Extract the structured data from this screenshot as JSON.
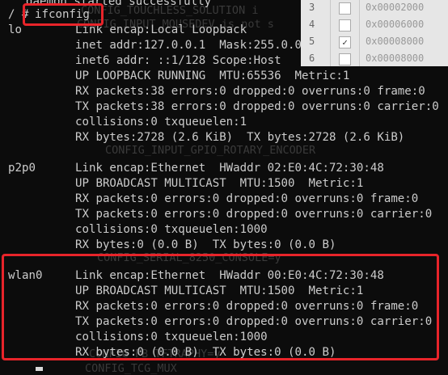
{
  "terminal": {
    "top_partial": "daemon started successfully",
    "prompt": "/ #",
    "command": "ifconfig",
    "interfaces": [
      {
        "name": "lo",
        "lines": [
          "Link encap:Local Loopback",
          "inet addr:127.0.0.1  Mask:255.0.0.0",
          "inet6 addr: ::1/128 Scope:Host",
          "UP LOOPBACK RUNNING  MTU:65536  Metric:1",
          "RX packets:38 errors:0 dropped:0 overruns:0 frame:0",
          "TX packets:38 errors:0 dropped:0 overruns:0 carrier:0",
          "collisions:0 txqueuelen:1",
          "RX bytes:2728 (2.6 KiB)  TX bytes:2728 (2.6 KiB)"
        ]
      },
      {
        "name": "p2p0",
        "lines": [
          "Link encap:Ethernet  HWaddr 02:E0:4C:72:30:48",
          "UP BROADCAST MULTICAST  MTU:1500  Metric:1",
          "RX packets:0 errors:0 dropped:0 overruns:0 frame:0",
          "TX packets:0 errors:0 dropped:0 overruns:0 carrier:0",
          "collisions:0 txqueuelen:1000",
          "RX bytes:0 (0.0 B)  TX bytes:0 (0.0 B)"
        ]
      },
      {
        "name": "wlan0",
        "lines": [
          "Link encap:Ethernet  HWaddr 00:E0:4C:72:30:48",
          "UP BROADCAST MULTICAST  MTU:1500  Metric:1",
          "RX packets:0 errors:0 dropped:0 overruns:0 frame:0",
          "TX packets:0 errors:0 dropped:0 overruns:0 carrier:0",
          "collisions:0 txqueuelen:1000",
          "RX bytes:0 (0.0 B)  TX bytes:0 (0.0 B)"
        ]
      }
    ]
  },
  "ghost_text": {
    "g1": "CONFIG_TOUCHLESS_SOLUTION i",
    "g2": "CONFIG_INPUT_MOUSEDEV is not s",
    "g3": "CONFIG_INPUT_GPIO_ROTARY_ENCODER",
    "g4": "CONFIG_SERIAL_8250_CONSOLE=y",
    "g5": "CONFIG_FB_TFTRAPHY=y",
    "g6": "CONFIG_TCG_MUX"
  },
  "register_panel": {
    "rows": [
      {
        "num": "3",
        "checked": false,
        "addr": "0x00002000"
      },
      {
        "num": "4",
        "checked": false,
        "addr": "0x00006000"
      },
      {
        "num": "5",
        "checked": true,
        "addr": "0x00008000"
      },
      {
        "num": "6",
        "checked": false,
        "addr": "0x00008000"
      }
    ]
  },
  "colors": {
    "background": "#0c0c0c",
    "text": "#cccccc",
    "highlight": "#e8242a"
  }
}
